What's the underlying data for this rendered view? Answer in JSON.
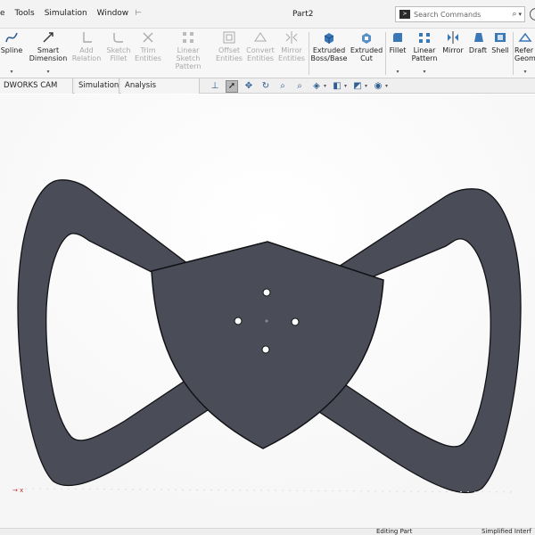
{
  "titlebar": {
    "menus": [
      "e",
      "Tools",
      "Simulation",
      "Window"
    ],
    "document_title": "Part2",
    "search_placeholder": "Search Commands"
  },
  "ribbon": {
    "tools": [
      {
        "id": "spline",
        "label": "Spline",
        "enabled": true,
        "icon": "spline-icon"
      },
      {
        "id": "smart-dimension",
        "label": "Smart Dimension",
        "enabled": true,
        "icon": "dimension-icon"
      },
      {
        "id": "add-relation",
        "label": "Add Relation",
        "enabled": false,
        "icon": "relation-icon"
      },
      {
        "id": "sketch-fillet",
        "label": "Sketch Fillet",
        "enabled": false,
        "icon": "sketch-fillet-icon"
      },
      {
        "id": "trim-entities",
        "label": "Trim Entities",
        "enabled": false,
        "icon": "trim-icon"
      },
      {
        "id": "linear-sketch-pattern",
        "label": "Linear Sketch Pattern",
        "enabled": false,
        "icon": "pattern-icon"
      },
      {
        "id": "offset-entities",
        "label": "Offset Entities",
        "enabled": false,
        "icon": "offset-icon"
      },
      {
        "id": "convert-entities",
        "label": "Convert Entities",
        "enabled": false,
        "icon": "convert-icon"
      },
      {
        "id": "mirror-entities",
        "label": "Mirror Entities",
        "enabled": false,
        "icon": "mirror-entities-icon"
      },
      {
        "id": "extruded-boss",
        "label": "Extruded Boss/Base",
        "enabled": true,
        "icon": "extrude-icon"
      },
      {
        "id": "extruded-cut",
        "label": "Extruded Cut",
        "enabled": true,
        "icon": "extrude-cut-icon"
      },
      {
        "id": "fillet",
        "label": "Fillet",
        "enabled": true,
        "icon": "fillet-icon"
      },
      {
        "id": "linear-pattern",
        "label": "Linear Pattern",
        "enabled": true,
        "icon": "linear-pattern-icon"
      },
      {
        "id": "mirror",
        "label": "Mirror",
        "enabled": true,
        "icon": "mirror-icon"
      },
      {
        "id": "draft",
        "label": "Draft",
        "enabled": true,
        "icon": "draft-icon"
      },
      {
        "id": "shell",
        "label": "Shell",
        "enabled": true,
        "icon": "shell-icon"
      },
      {
        "id": "reference-geometry",
        "label": "Refer Geom",
        "enabled": true,
        "icon": "reference-geometry-icon"
      }
    ]
  },
  "tabs": [
    "DWORKS CAM TBM",
    "Simulation",
    "Analysis Preparation"
  ],
  "status": {
    "mode": "Editing Part",
    "interface": "Simplified Interf"
  },
  "colors": {
    "part_fill": "#4a4d58",
    "part_edge": "#121216",
    "accent_blue": "#2f5e91"
  }
}
